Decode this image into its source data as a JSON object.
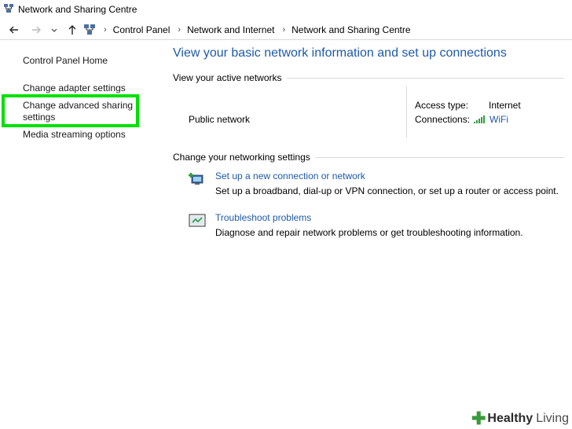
{
  "window": {
    "title": "Network and Sharing Centre"
  },
  "addressbar": {
    "breadcrumbs": [
      "Control Panel",
      "Network and Internet",
      "Network and Sharing Centre"
    ]
  },
  "left": {
    "links": [
      "Control Panel Home",
      "Change adapter settings",
      "Change advanced sharing settings",
      "Media streaming options"
    ],
    "highlight_color": "#00e000"
  },
  "main": {
    "heading": "View your basic network information and set up connections",
    "active_networks_title": "View your active networks",
    "network_name": "Public network",
    "access_type_label": "Access type:",
    "access_type_value": "Internet",
    "connections_label": "Connections:",
    "connections_value": "WiFi",
    "change_settings_title": "Change your networking settings",
    "tasks": [
      {
        "link": "Set up a new connection or network",
        "description": "Set up a broadband, dial-up or VPN connection, or set up a router or access point."
      },
      {
        "link": "Troubleshoot problems",
        "description": "Diagnose and repair network problems or get troubleshooting information."
      }
    ]
  },
  "watermark": {
    "brand": "Healthy",
    "brand2": "Living"
  },
  "colors": {
    "link": "#1e5aa8",
    "highlight": "#00e000"
  }
}
